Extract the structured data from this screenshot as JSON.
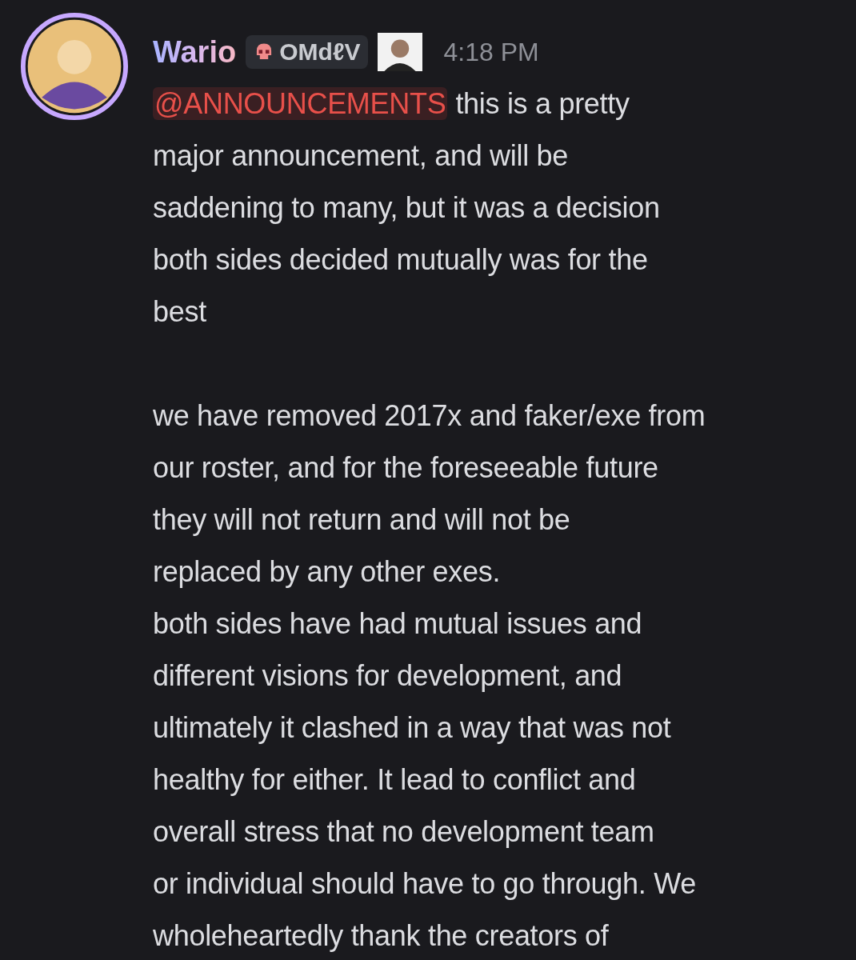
{
  "message": {
    "author": "Wario",
    "role_tag": "OMdℓV",
    "timestamp": "4:18 PM",
    "mention": "@ANNOUNCEMENTS",
    "sections": [
      {
        "paragraphs": [
          {
            "lines": [
              "this is a pretty",
              "major announcement, and will be",
              "saddening to many, but it was a decision",
              "both sides decided mutually was for the",
              "best"
            ]
          }
        ]
      },
      {
        "paragraphs": [
          {
            "lines": [
              "we have removed 2017x and faker/exe from",
              "our roster, and for the foreseeable future",
              "they will not return and will not be",
              "replaced by any other exes."
            ]
          },
          {
            "lines": [
              "both sides have had mutual issues and",
              "different visions for development, and",
              "ultimately it clashed in a way that was not",
              "healthy for either. It lead to conflict and",
              "overall stress that no development team",
              "or individual should have to go through. We",
              "wholeheartedly thank the creators of"
            ]
          }
        ]
      }
    ]
  }
}
